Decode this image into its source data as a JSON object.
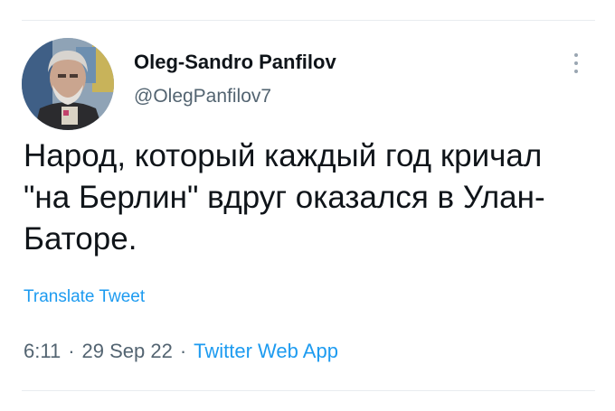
{
  "author": {
    "name": "Oleg-Sandro Panfilov",
    "handle": "@OlegPanfilov7"
  },
  "tweet": {
    "text": "Народ, который каждый год кричал \"на Берлин\" вдруг оказался в Улан-Баторе.",
    "translate_label": "Translate Tweet"
  },
  "meta": {
    "time": "6:11",
    "separator": "·",
    "date": "29 Sep 22",
    "source": "Twitter Web App"
  },
  "colors": {
    "link": "#1d9bf0",
    "secondary_text": "#536471",
    "primary_text": "#0f1419"
  },
  "icons": {
    "more": "more-vertical-icon",
    "avatar": "avatar"
  }
}
